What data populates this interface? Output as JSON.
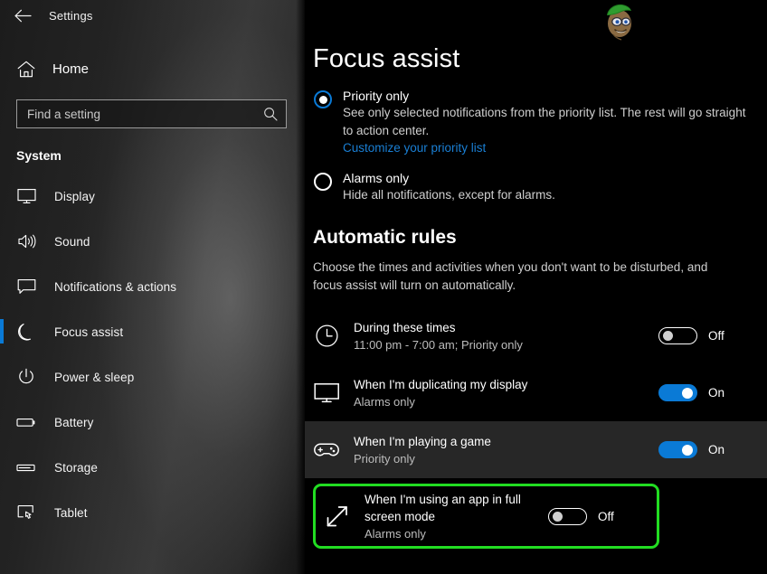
{
  "colors": {
    "accent": "#0a7ad6",
    "link": "#1a7fd4",
    "highlight": "#22dd22",
    "sidebar_selected_bar": "#0a7ad6"
  },
  "titlebar": {
    "back_label": "Back",
    "title": "Settings"
  },
  "sidebar": {
    "home_label": "Home",
    "search": {
      "placeholder": "Find a setting",
      "value": ""
    },
    "section_title": "System",
    "items": [
      {
        "label": "Display",
        "icon": "monitor-icon",
        "selected": false
      },
      {
        "label": "Sound",
        "icon": "speaker-icon",
        "selected": false
      },
      {
        "label": "Notifications & actions",
        "icon": "notification-icon",
        "selected": false
      },
      {
        "label": "Focus assist",
        "icon": "moon-icon",
        "selected": true
      },
      {
        "label": "Power & sleep",
        "icon": "power-icon",
        "selected": false
      },
      {
        "label": "Battery",
        "icon": "battery-icon",
        "selected": false
      },
      {
        "label": "Storage",
        "icon": "storage-icon",
        "selected": false
      },
      {
        "label": "Tablet",
        "icon": "tablet-icon",
        "selected": false
      }
    ]
  },
  "main": {
    "page_title": "Focus assist",
    "options": [
      {
        "title": "Priority only",
        "description": "See only selected notifications from the priority list. The rest will go straight to action center.",
        "link": "Customize your priority list",
        "selected": true
      },
      {
        "title": "Alarms only",
        "description": "Hide all notifications, except for alarms.",
        "link": "",
        "selected": false
      }
    ],
    "automatic_rules": {
      "heading": "Automatic rules",
      "description": "Choose the times and activities when you don't want to be disturbed, and focus assist will turn on automatically.",
      "rules": [
        {
          "title": "During these times",
          "subtitle": "11:00 pm - 7:00 am; Priority only",
          "icon": "clock-icon",
          "state": "Off",
          "on": false,
          "hover": false,
          "highlighted": false
        },
        {
          "title": "When I'm duplicating my display",
          "subtitle": "Alarms only",
          "icon": "monitor-icon",
          "state": "On",
          "on": true,
          "hover": false,
          "highlighted": false
        },
        {
          "title": "When I'm playing a game",
          "subtitle": "Priority only",
          "icon": "gamepad-icon",
          "state": "On",
          "on": true,
          "hover": true,
          "highlighted": false
        },
        {
          "title": "When I'm using an app in full screen mode",
          "subtitle": "Alarms only",
          "icon": "fullscreen-arrows-icon",
          "state": "Off",
          "on": false,
          "hover": false,
          "highlighted": true
        }
      ]
    }
  }
}
